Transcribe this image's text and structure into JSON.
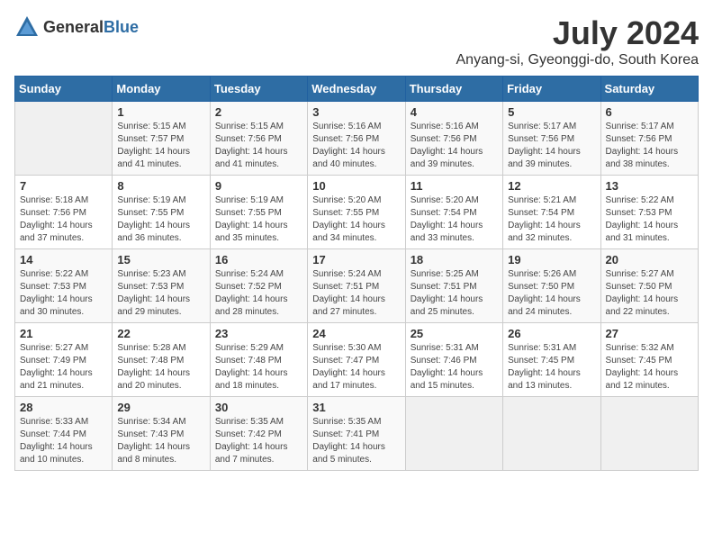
{
  "header": {
    "logo_general": "General",
    "logo_blue": "Blue",
    "title": "July 2024",
    "subtitle": "Anyang-si, Gyeonggi-do, South Korea"
  },
  "calendar": {
    "days_of_week": [
      "Sunday",
      "Monday",
      "Tuesday",
      "Wednesday",
      "Thursday",
      "Friday",
      "Saturday"
    ],
    "weeks": [
      [
        {
          "day": "",
          "info": ""
        },
        {
          "day": "1",
          "info": "Sunrise: 5:15 AM\nSunset: 7:57 PM\nDaylight: 14 hours\nand 41 minutes."
        },
        {
          "day": "2",
          "info": "Sunrise: 5:15 AM\nSunset: 7:56 PM\nDaylight: 14 hours\nand 41 minutes."
        },
        {
          "day": "3",
          "info": "Sunrise: 5:16 AM\nSunset: 7:56 PM\nDaylight: 14 hours\nand 40 minutes."
        },
        {
          "day": "4",
          "info": "Sunrise: 5:16 AM\nSunset: 7:56 PM\nDaylight: 14 hours\nand 39 minutes."
        },
        {
          "day": "5",
          "info": "Sunrise: 5:17 AM\nSunset: 7:56 PM\nDaylight: 14 hours\nand 39 minutes."
        },
        {
          "day": "6",
          "info": "Sunrise: 5:17 AM\nSunset: 7:56 PM\nDaylight: 14 hours\nand 38 minutes."
        }
      ],
      [
        {
          "day": "7",
          "info": "Sunrise: 5:18 AM\nSunset: 7:56 PM\nDaylight: 14 hours\nand 37 minutes."
        },
        {
          "day": "8",
          "info": "Sunrise: 5:19 AM\nSunset: 7:55 PM\nDaylight: 14 hours\nand 36 minutes."
        },
        {
          "day": "9",
          "info": "Sunrise: 5:19 AM\nSunset: 7:55 PM\nDaylight: 14 hours\nand 35 minutes."
        },
        {
          "day": "10",
          "info": "Sunrise: 5:20 AM\nSunset: 7:55 PM\nDaylight: 14 hours\nand 34 minutes."
        },
        {
          "day": "11",
          "info": "Sunrise: 5:20 AM\nSunset: 7:54 PM\nDaylight: 14 hours\nand 33 minutes."
        },
        {
          "day": "12",
          "info": "Sunrise: 5:21 AM\nSunset: 7:54 PM\nDaylight: 14 hours\nand 32 minutes."
        },
        {
          "day": "13",
          "info": "Sunrise: 5:22 AM\nSunset: 7:53 PM\nDaylight: 14 hours\nand 31 minutes."
        }
      ],
      [
        {
          "day": "14",
          "info": "Sunrise: 5:22 AM\nSunset: 7:53 PM\nDaylight: 14 hours\nand 30 minutes."
        },
        {
          "day": "15",
          "info": "Sunrise: 5:23 AM\nSunset: 7:53 PM\nDaylight: 14 hours\nand 29 minutes."
        },
        {
          "day": "16",
          "info": "Sunrise: 5:24 AM\nSunset: 7:52 PM\nDaylight: 14 hours\nand 28 minutes."
        },
        {
          "day": "17",
          "info": "Sunrise: 5:24 AM\nSunset: 7:51 PM\nDaylight: 14 hours\nand 27 minutes."
        },
        {
          "day": "18",
          "info": "Sunrise: 5:25 AM\nSunset: 7:51 PM\nDaylight: 14 hours\nand 25 minutes."
        },
        {
          "day": "19",
          "info": "Sunrise: 5:26 AM\nSunset: 7:50 PM\nDaylight: 14 hours\nand 24 minutes."
        },
        {
          "day": "20",
          "info": "Sunrise: 5:27 AM\nSunset: 7:50 PM\nDaylight: 14 hours\nand 22 minutes."
        }
      ],
      [
        {
          "day": "21",
          "info": "Sunrise: 5:27 AM\nSunset: 7:49 PM\nDaylight: 14 hours\nand 21 minutes."
        },
        {
          "day": "22",
          "info": "Sunrise: 5:28 AM\nSunset: 7:48 PM\nDaylight: 14 hours\nand 20 minutes."
        },
        {
          "day": "23",
          "info": "Sunrise: 5:29 AM\nSunset: 7:48 PM\nDaylight: 14 hours\nand 18 minutes."
        },
        {
          "day": "24",
          "info": "Sunrise: 5:30 AM\nSunset: 7:47 PM\nDaylight: 14 hours\nand 17 minutes."
        },
        {
          "day": "25",
          "info": "Sunrise: 5:31 AM\nSunset: 7:46 PM\nDaylight: 14 hours\nand 15 minutes."
        },
        {
          "day": "26",
          "info": "Sunrise: 5:31 AM\nSunset: 7:45 PM\nDaylight: 14 hours\nand 13 minutes."
        },
        {
          "day": "27",
          "info": "Sunrise: 5:32 AM\nSunset: 7:45 PM\nDaylight: 14 hours\nand 12 minutes."
        }
      ],
      [
        {
          "day": "28",
          "info": "Sunrise: 5:33 AM\nSunset: 7:44 PM\nDaylight: 14 hours\nand 10 minutes."
        },
        {
          "day": "29",
          "info": "Sunrise: 5:34 AM\nSunset: 7:43 PM\nDaylight: 14 hours\nand 8 minutes."
        },
        {
          "day": "30",
          "info": "Sunrise: 5:35 AM\nSunset: 7:42 PM\nDaylight: 14 hours\nand 7 minutes."
        },
        {
          "day": "31",
          "info": "Sunrise: 5:35 AM\nSunset: 7:41 PM\nDaylight: 14 hours\nand 5 minutes."
        },
        {
          "day": "",
          "info": ""
        },
        {
          "day": "",
          "info": ""
        },
        {
          "day": "",
          "info": ""
        }
      ]
    ]
  }
}
